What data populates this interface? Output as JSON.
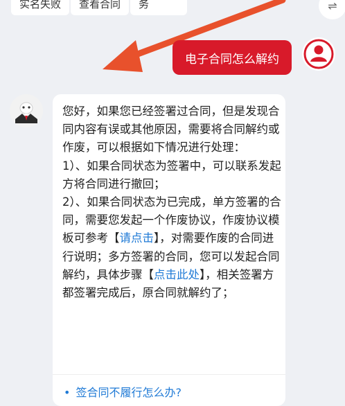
{
  "top_buttons": [
    "实名失败",
    "查看合同",
    "自助服务"
  ],
  "switch_icon": "⇌",
  "user_message": "电子合同怎么解约",
  "bot_reply": {
    "intro": "您好，如果您已经签署过合同，但是发现合同内容有误或其他原因，需要将合同解约或作废，可以根据如下情况进行处理：",
    "point1": "1）、如果合同状态为签署中，可以联系发起方将合同进行撤回；",
    "point2_a": "2）、如果合同状态为已完成，单方签署的合同，需要您发起一个作废协议，作废协议模板可参考【",
    "point2_link1": "请点击",
    "point2_b": "】，对需要作废的合同进行说明；多方签署的合同，您可以发起合同解约，具体步骤【",
    "point2_link2": "点击此处",
    "point2_c": "】，相关签署方都签署完成后，原合同就解约了；"
  },
  "suggestion": "签合同不履行怎么办?",
  "colors": {
    "accent": "#d81a2a",
    "link": "#1f7ad6",
    "arrow": "#e8512c",
    "background": "#eef0f4"
  }
}
